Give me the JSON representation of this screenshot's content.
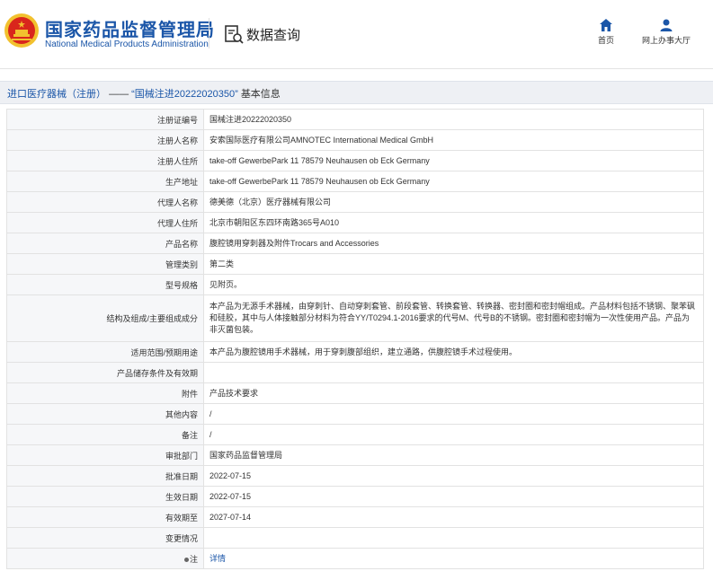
{
  "header": {
    "org_name_cn": "国家药品监督管理局",
    "org_name_en": "National Medical Products Administration",
    "data_query_label": "数据查询",
    "nav": [
      {
        "label": "首页",
        "icon": "home-icon"
      },
      {
        "label": "网上办事大厅",
        "icon": "user-icon"
      }
    ]
  },
  "breadcrumb": {
    "category": "进口医疗器械（注册）",
    "separator": "——",
    "reg_number": "“国械注进20222020350”",
    "tail": "基本信息"
  },
  "colors": {
    "brand_blue": "#1b56a8",
    "key_bg": "#f6f7f9",
    "border": "#e2e2e2"
  },
  "record": {
    "reg_no": {
      "label": "注册证编号",
      "value": "国械注进20222020350"
    },
    "registrant": {
      "label": "注册人名称",
      "value": "安索国际医疗有限公司AMNOTEC International Medical GmbH"
    },
    "reg_address": {
      "label": "注册人住所",
      "value": "take-off GewerbePark 11 78579 Neuhausen ob Eck Germany"
    },
    "prod_address": {
      "label": "生产地址",
      "value": "take-off GewerbePark 11 78579 Neuhausen ob Eck Germany"
    },
    "agent": {
      "label": "代理人名称",
      "value": "德美德（北京）医疗器械有限公司"
    },
    "agent_address": {
      "label": "代理人住所",
      "value": "北京市朝阳区东四环南路365号A010"
    },
    "product_name": {
      "label": "产品名称",
      "value": "腹腔镜用穿刺器及附件Trocars and Accessories"
    },
    "mgmt_class": {
      "label": "管理类别",
      "value": "第二类"
    },
    "model_spec": {
      "label": "型号规格",
      "value": "见附页。"
    },
    "structure": {
      "label": "结构及组成/主要组成成分",
      "value": "本产品为无源手术器械，由穿刺针、自动穿刺套管、前段套管、转换套管、转换器、密封圈和密封帽组成。产品材料包括不锈钢、聚苯砜和硅胶，其中与人体接触部分材料为符合YY/T0294.1-2016要求的代号M、代号B的不锈钢。密封圈和密封帽为一次性使用产品。产品为非灭菌包装。"
    },
    "scope": {
      "label": "适用范围/预期用途",
      "value": "本产品为腹腔镜用手术器械，用于穿刺腹部组织，建立通路，供腹腔镜手术过程使用。"
    },
    "storage": {
      "label": "产品储存条件及有效期",
      "value": ""
    },
    "attachment": {
      "label": "附件",
      "value": "产品技术要求"
    },
    "other": {
      "label": "其他内容",
      "value": "/"
    },
    "remark": {
      "label": "备注",
      "value": "/"
    },
    "approver": {
      "label": "审批部门",
      "value": "国家药品监督管理局"
    },
    "approval_date": {
      "label": "批准日期",
      "value": "2022-07-15"
    },
    "effective_date": {
      "label": "生效日期",
      "value": "2022-07-15"
    },
    "expiry_date": {
      "label": "有效期至",
      "value": "2027-07-14"
    },
    "changes": {
      "label": "变更情况",
      "value": ""
    },
    "note": {
      "label": "注",
      "value": "详情"
    }
  }
}
